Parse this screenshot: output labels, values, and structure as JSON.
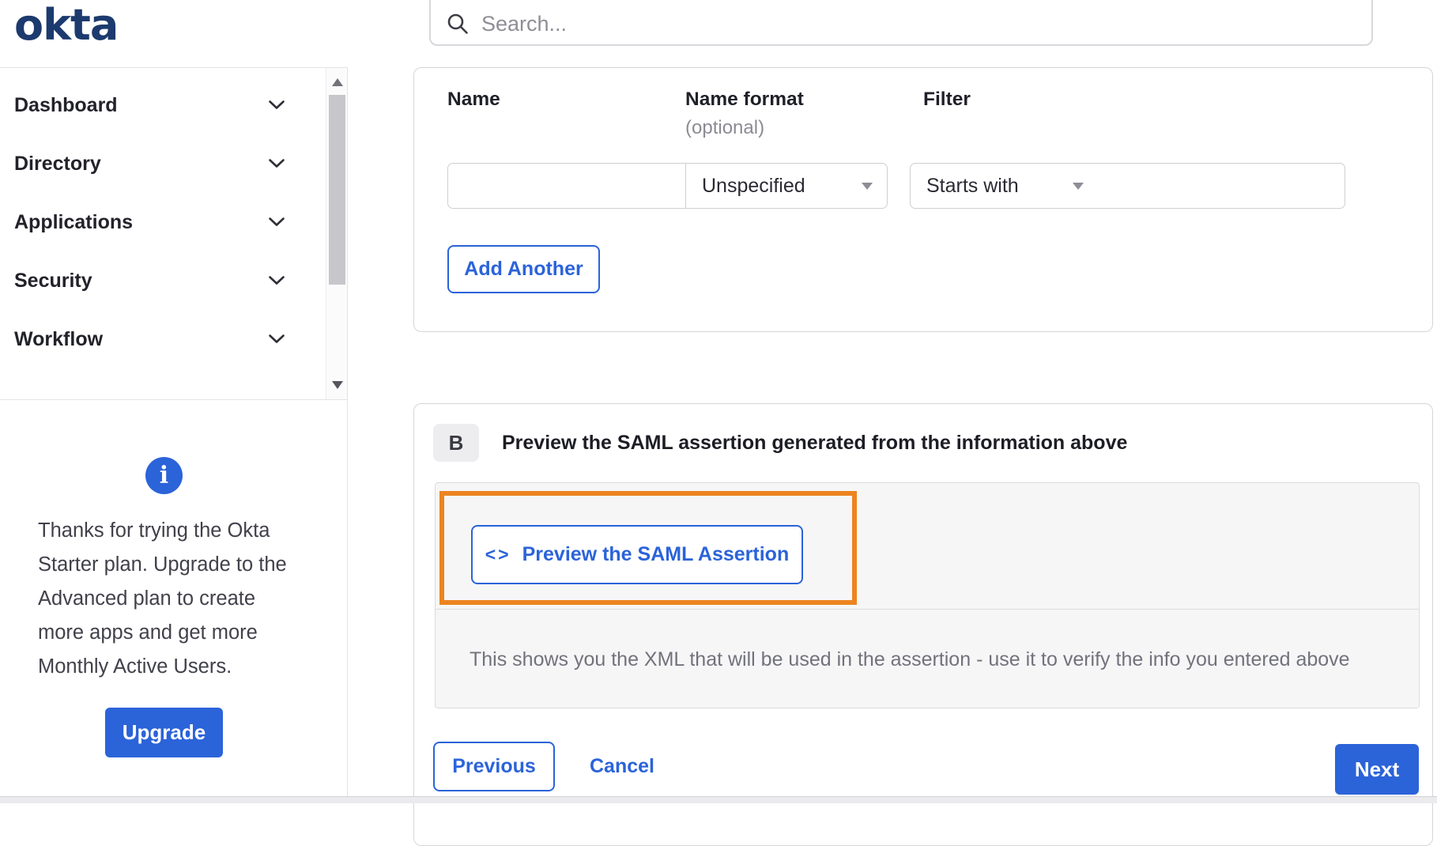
{
  "colors": {
    "accent_blue": "#2b63d9",
    "annotation_orange": "#ec8420",
    "logo_navy": "#1c3a6e"
  },
  "header": {
    "logo_text": "okta",
    "search": {
      "placeholder": "Search..."
    }
  },
  "sidebar": {
    "items": [
      {
        "label": "Dashboard"
      },
      {
        "label": "Directory"
      },
      {
        "label": "Applications"
      },
      {
        "label": "Security"
      },
      {
        "label": "Workflow"
      }
    ],
    "upgrade_notice": {
      "info_icon_glyph": "i",
      "text": "Thanks for trying the Okta Starter plan. Upgrade to the Advanced plan to create more apps and get more Monthly Active Users.",
      "button_label": "Upgrade"
    }
  },
  "attribute_form": {
    "columns": {
      "name_label": "Name",
      "format_label": "Name format",
      "format_optional": "(optional)",
      "filter_label": "Filter"
    },
    "row": {
      "name_value": "",
      "format_selected": "Unspecified",
      "filter_op_selected": "Starts with",
      "filter_value": ""
    },
    "add_another_label": "Add Another"
  },
  "preview_section": {
    "badge": "B",
    "heading": "Preview the SAML assertion generated from the information above",
    "preview_button": {
      "icon_glyph": "<>",
      "label": "Preview the SAML Assertion"
    },
    "description": "This shows you the XML that will be used in the assertion - use it to verify the info you entered above"
  },
  "footer": {
    "previous_label": "Previous",
    "cancel_label": "Cancel",
    "next_label": "Next"
  }
}
